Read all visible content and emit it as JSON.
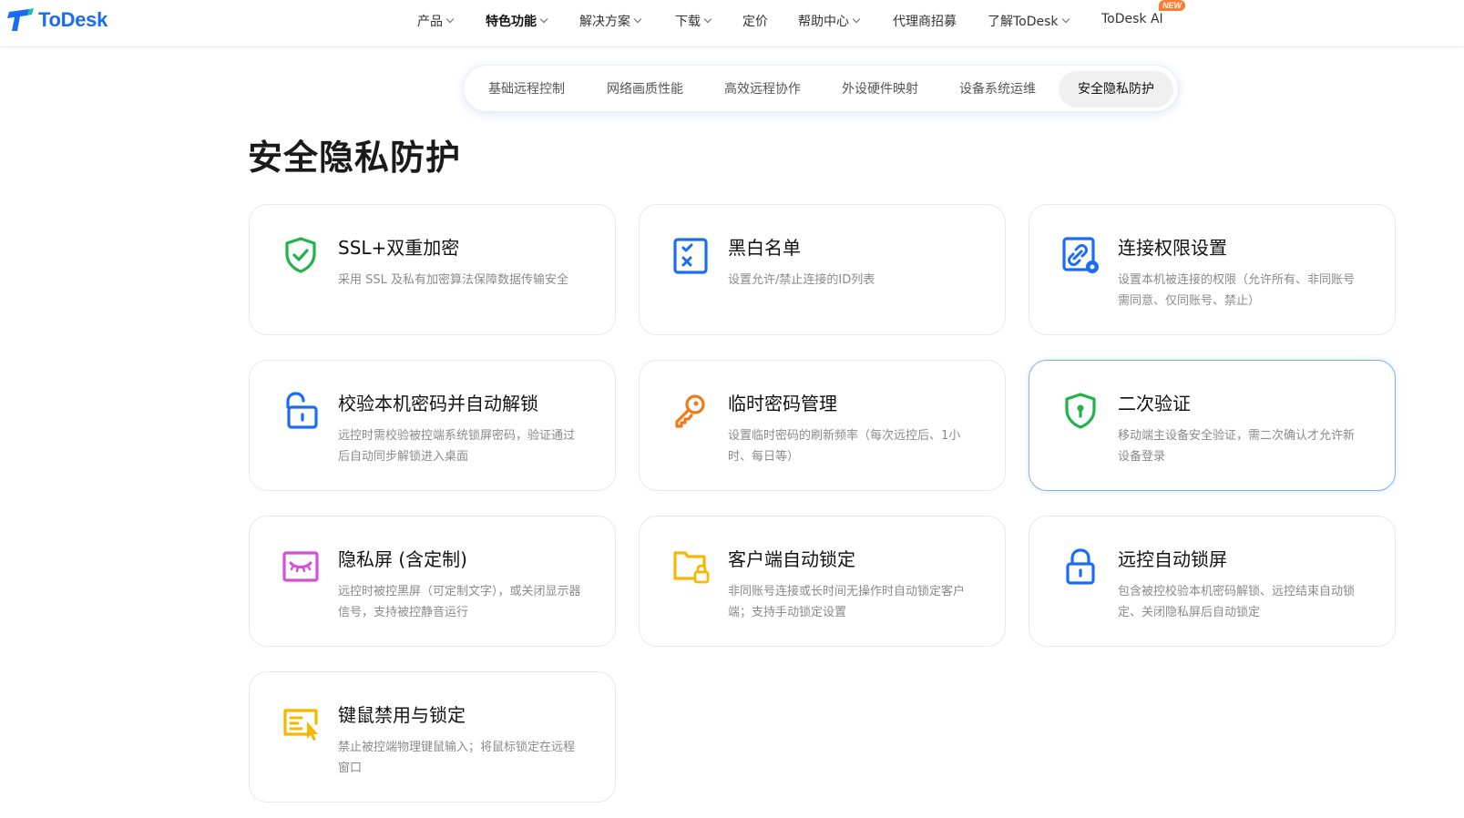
{
  "brand": {
    "name": "ToDesk",
    "color": "#1a6cf5"
  },
  "nav": {
    "items": [
      {
        "label": "产品",
        "dropdown": true,
        "active": false
      },
      {
        "label": "特色功能",
        "dropdown": true,
        "active": true
      },
      {
        "label": "解决方案",
        "dropdown": true,
        "active": false
      },
      {
        "label": "下载",
        "dropdown": true,
        "active": false
      },
      {
        "label": "定价",
        "dropdown": false,
        "active": false
      },
      {
        "label": "帮助中心",
        "dropdown": true,
        "active": false
      },
      {
        "label": "代理商招募",
        "dropdown": false,
        "active": false
      },
      {
        "label": "了解ToDesk",
        "dropdown": true,
        "active": false
      },
      {
        "label": "ToDesk AI",
        "dropdown": false,
        "active": false
      }
    ],
    "new_badge": "NEW"
  },
  "subtabs": {
    "items": [
      "基础远程控制",
      "网络画质性能",
      "高效远程协作",
      "外设硬件映射",
      "设备系统运维",
      "安全隐私防护"
    ],
    "active": "安全隐私防护"
  },
  "section_title": "安全隐私防护",
  "cards": [
    {
      "icon": "shield-check-icon",
      "title": "SSL+双重加密",
      "desc": "采用 SSL 及私有加密算法保障数据传输安全",
      "color": "#1fb34a"
    },
    {
      "icon": "checklist-icon",
      "title": "黑白名单",
      "desc": "设置允许/禁止连接的ID列表",
      "color": "#1a6cf5"
    },
    {
      "icon": "link-settings-icon",
      "title": "连接权限设置",
      "desc": "设置本机被连接的权限（允许所有、非同账号需同意、仅同账号、禁止）",
      "color": "#1a6cf5"
    },
    {
      "icon": "unlock-icon",
      "title": "校验本机密码并自动解锁",
      "desc": "远控时需校验被控端系统锁屏密码，验证通过后自动同步解锁进入桌面",
      "color": "#1a6cf5"
    },
    {
      "icon": "key-icon",
      "title": "临时密码管理",
      "desc": "设置临时密码的刷新频率（每次远控后、1小时、每日等）",
      "color": "#f07a18"
    },
    {
      "icon": "shield-keyhole-icon",
      "title": "二次验证",
      "desc": "移动端主设备安全验证，需二次确认才允许新设备登录",
      "color": "#1fb34a"
    },
    {
      "icon": "privacy-screen-icon",
      "title": "隐私屏 (含定制)",
      "desc": "远控时被控黑屏（可定制文字），或关闭显示器信号，支持被控静音运行",
      "color": "#d64fd8"
    },
    {
      "icon": "folder-lock-icon",
      "title": "客户端自动锁定",
      "desc": "非同账号连接或长时间无操作时自动锁定客户端；支持手动锁定设置",
      "color": "#f5b700"
    },
    {
      "icon": "lock-icon",
      "title": "远控自动锁屏",
      "desc": "包含被控校验本机密码解锁、远控结束自动锁定、关闭隐私屏后自动锁定",
      "color": "#1a6cf5"
    },
    {
      "icon": "keyboard-mouse-lock-icon",
      "title": "键鼠禁用与锁定",
      "desc": "禁止被控端物理键鼠输入；将鼠标锁定在远程窗口",
      "color": "#f5b700"
    }
  ]
}
